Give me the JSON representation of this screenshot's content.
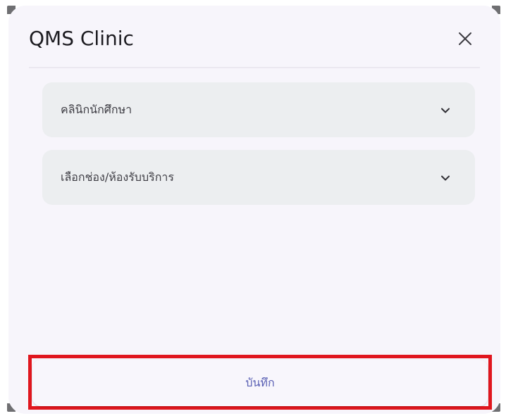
{
  "dialog": {
    "title": "QMS Clinic",
    "close_icon": "close-icon"
  },
  "fields": [
    {
      "value": "คลินิกนักศึกษา",
      "icon": "chevron-down-icon"
    },
    {
      "value": "เลือกช่อง/ห้องรับบริการ",
      "icon": "chevron-down-icon"
    }
  ],
  "save_button": {
    "label": "บันทึก"
  },
  "colors": {
    "dialog_bg": "#f7f5fb",
    "field_bg": "#eceef0",
    "accent": "#5a60b4",
    "highlight": "#e0161e"
  }
}
